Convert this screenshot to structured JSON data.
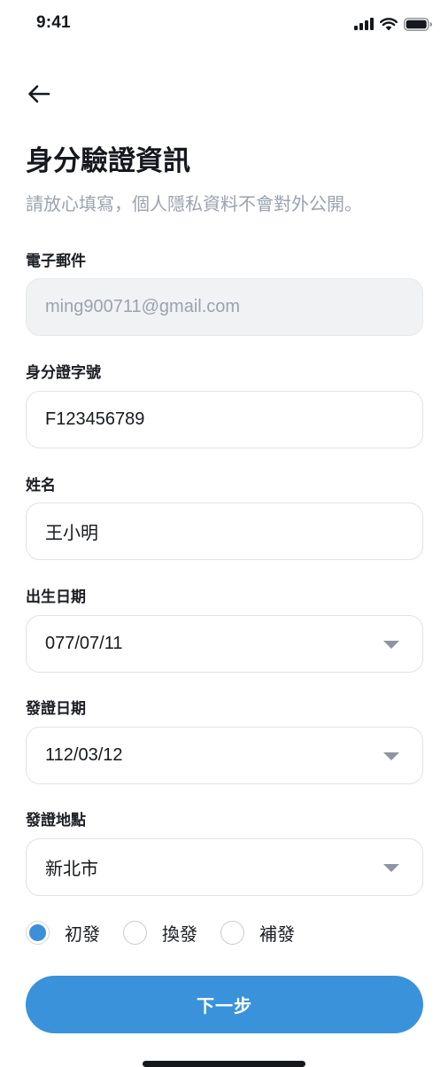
{
  "status_bar": {
    "time": "9:41",
    "icons": [
      "cellular-signal-icon",
      "wifi-icon",
      "battery-icon"
    ]
  },
  "header": {
    "back_icon": "arrow-left-icon",
    "title": "身分驗證資訊",
    "subtitle": "請放心填寫，個人隱私資料不會對外公開。"
  },
  "form": {
    "email": {
      "label": "電子郵件",
      "value": "ming900711@gmail.com",
      "disabled": true
    },
    "id_number": {
      "label": "身分證字號",
      "value": "F123456789"
    },
    "name": {
      "label": "姓名",
      "value": "王小明"
    },
    "birth_date": {
      "label": "出生日期",
      "value": "077/07/11"
    },
    "issue_date": {
      "label": "發證日期",
      "value": "112/03/12"
    },
    "issue_place": {
      "label": "發證地點",
      "value": "新北市"
    },
    "issue_type": {
      "options": [
        {
          "label": "初發",
          "checked": true
        },
        {
          "label": "換發",
          "checked": false
        },
        {
          "label": "補發",
          "checked": false
        }
      ]
    }
  },
  "actions": {
    "next_label": "下一步"
  },
  "colors": {
    "primary": "#3a92da",
    "text": "#15181d",
    "muted": "#9ba3ad",
    "border": "#dfe2e6",
    "disabled_bg": "#f1f2f4"
  }
}
